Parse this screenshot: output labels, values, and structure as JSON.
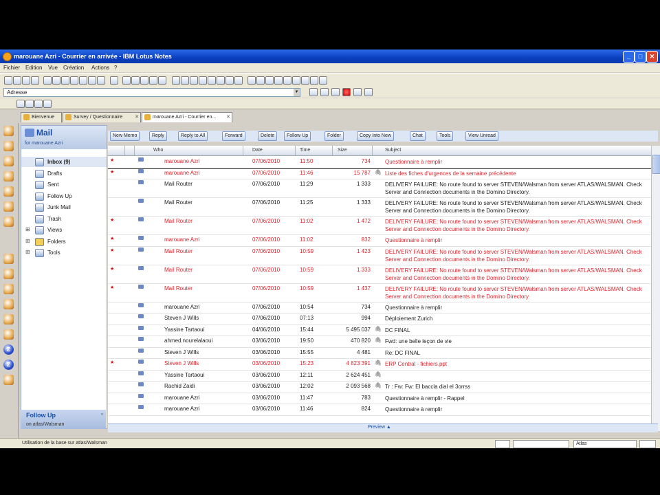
{
  "window": {
    "title": "marouane Azri - Courrier en arrivée - IBM Lotus Notes"
  },
  "menu": [
    "Fichier",
    "Edition",
    "Vue",
    "Création",
    "Actions",
    "?"
  ],
  "address": {
    "value": "Adresse"
  },
  "tabs": [
    {
      "label": "Bienvenue"
    },
    {
      "label": "Survey / Questionnaire"
    },
    {
      "label": "marouane Azri - Courrier en..."
    }
  ],
  "nav": {
    "title": "Mail",
    "subtitle": "for marouane Azri",
    "items": [
      {
        "label": "Inbox (9)",
        "selected": true
      },
      {
        "label": "Drafts"
      },
      {
        "label": "Sent"
      },
      {
        "label": "Follow Up"
      },
      {
        "label": "Junk Mail"
      },
      {
        "label": "Trash"
      },
      {
        "label": "Views"
      },
      {
        "label": "Folders"
      },
      {
        "label": "Tools"
      }
    ],
    "footer_label": "Follow Up",
    "footer_sub": "on atlas/Walsman"
  },
  "actions": [
    "New Memo",
    "Reply",
    "Reply to All",
    "Forward",
    "Delete",
    "Follow Up",
    "Folder",
    "Copy Into New",
    "Chat",
    "Tools",
    "View Unread"
  ],
  "columns": {
    "who": "Who",
    "date": "Date",
    "time": "Time",
    "size": "Size",
    "subject": "Subject"
  },
  "messages": [
    {
      "who": "marouane Azri",
      "date": "07/06/2010",
      "time": "11:50",
      "size": "734",
      "subject": "Questionnaire à remplir",
      "unread": true
    },
    {
      "who": "marouane Azri",
      "date": "07/06/2010",
      "time": "11:46",
      "size": "15 787",
      "subject": "Liste des fiches d'urgences de la semaine précédente",
      "unread": true,
      "clip": true
    },
    {
      "who": "Mail Router",
      "date": "07/06/2010",
      "time": "11:29",
      "size": "1 333",
      "subject": "DELIVERY FAILURE: No route found to server STEVEN/Walsman from server ATLAS/WALSMAN. Check Server and Connection documents in the Domino Directory.",
      "unread": false
    },
    {
      "who": "Mail Router",
      "date": "07/06/2010",
      "time": "11:25",
      "size": "1 333",
      "subject": "DELIVERY FAILURE: No route found to server STEVEN/Walsman from server ATLAS/WALSMAN. Check Server and Connection documents in the Domino Directory.",
      "unread": false
    },
    {
      "who": "Mail Router",
      "date": "07/06/2010",
      "time": "11:02",
      "size": "1 472",
      "subject": "DELIVERY FAILURE: No route found to server STEVEN/Walsman from server ATLAS/WALSMAN. Check Server and Connection documents in the Domino Directory.",
      "unread": true
    },
    {
      "who": "marouane Azri",
      "date": "07/06/2010",
      "time": "11:02",
      "size": "832",
      "subject": "Questionnaire à remplir",
      "unread": true
    },
    {
      "who": "Mail Router",
      "date": "07/06/2010",
      "time": "10:59",
      "size": "1 423",
      "subject": "DELIVERY FAILURE: No route found to server STEVEN/Walsman from server ATLAS/WALSMAN. Check Server and Connection documents in the Domino Directory.",
      "unread": true
    },
    {
      "who": "Mail Router",
      "date": "07/06/2010",
      "time": "10:59",
      "size": "1 333",
      "subject": "DELIVERY FAILURE: No route found to server STEVEN/Walsman from server ATLAS/WALSMAN. Check Server and Connection documents in the Domino Directory.",
      "unread": true
    },
    {
      "who": "Mail Router",
      "date": "07/06/2010",
      "time": "10:59",
      "size": "1 437",
      "subject": "DELIVERY FAILURE: No route found to server STEVEN/Walsman from server ATLAS/WALSMAN. Check Server and Connection documents in the Domino Directory.",
      "unread": true
    },
    {
      "who": "marouane Azri",
      "date": "07/06/2010",
      "time": "10:54",
      "size": "734",
      "subject": "Questionnaire à remplir",
      "unread": false
    },
    {
      "who": "Steven J Wills",
      "date": "07/06/2010",
      "time": "07:13",
      "size": "994",
      "subject": "Déploiement Zurich",
      "unread": false
    },
    {
      "who": "Yassine Tartaoui",
      "date": "04/06/2010",
      "time": "15:44",
      "size": "5 495 037",
      "subject": "DC FINAL",
      "unread": false,
      "clip": true
    },
    {
      "who": "ahmed.nourelalaoui",
      "date": "03/06/2010",
      "time": "19:50",
      "size": "470 820",
      "subject": "Fwd: une belle leçon de vie",
      "unread": false,
      "clip": true
    },
    {
      "who": "Steven J Wills",
      "date": "03/06/2010",
      "time": "15:55",
      "size": "4 481",
      "subject": "Re: DC FINAL",
      "unread": false
    },
    {
      "who": "Steven J Wills",
      "date": "03/06/2010",
      "time": "15:23",
      "size": "4 823 391",
      "subject": "ERP Central - fichiers.ppt",
      "unread": true,
      "clip": true
    },
    {
      "who": "Yassine Tartaoui",
      "date": "03/06/2010",
      "time": "12:11",
      "size": "2 624 451",
      "subject": "",
      "unread": false,
      "clip": true
    },
    {
      "who": "Rachid Zaidi",
      "date": "03/06/2010",
      "time": "12:02",
      "size": "2 093 568",
      "subject": "Tr : Fw: Fw: El baccla dial el 3orrss",
      "unread": false,
      "clip": true
    },
    {
      "who": "marouane Azri",
      "date": "03/06/2010",
      "time": "11:47",
      "size": "783",
      "subject": "Questionnaire à remplir - Rappel",
      "unread": false
    },
    {
      "who": "marouane Azri",
      "date": "03/06/2010",
      "time": "11:46",
      "size": "824",
      "subject": "Questionnaire à remplir",
      "unread": false
    }
  ],
  "preview_label": "Preview ▲",
  "status": {
    "text": "Utilisation de la base sur atlas/Walsman",
    "location": "Atlas"
  }
}
